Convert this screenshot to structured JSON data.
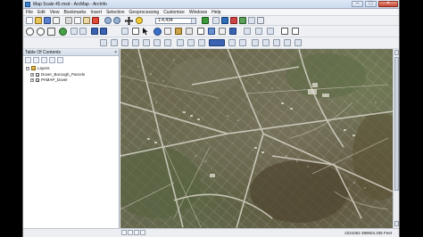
{
  "window": {
    "title": "Map Scale 45.mxd - ArcMap - ArcInfo",
    "controls": [
      "minimize",
      "maximize",
      "close"
    ]
  },
  "menu": [
    "File",
    "Edit",
    "View",
    "Bookmarks",
    "Insert",
    "Selection",
    "Geoprocessing",
    "Customize",
    "Windows",
    "Help"
  ],
  "toolbar": {
    "scale_value": "1:4,434"
  },
  "toc": {
    "title": "Table Of Contents",
    "close_glyph": "×",
    "root_label": "Layers",
    "layers": [
      {
        "name": "Dover_Borough_Parcels",
        "checked": true
      },
      {
        "name": "PAMAP_Dover",
        "checked": true
      }
    ]
  },
  "status": {
    "coordinates": "2224362  389504.335 Feet"
  },
  "colors": {
    "title_bar": "#c9d9ee",
    "map_base": "#6c6a55",
    "roads": "#d8d4c8"
  }
}
